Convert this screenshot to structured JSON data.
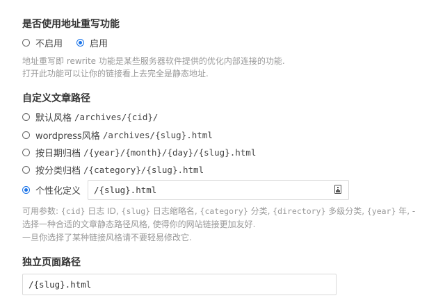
{
  "rewrite": {
    "title": "是否使用地址重写功能",
    "options": [
      {
        "label": "不启用",
        "checked": false
      },
      {
        "label": "启用",
        "checked": true
      }
    ],
    "desc_line1": "地址重写即 rewrite 功能是某些服务器软件提供的优化内部连接的功能.",
    "desc_line2": "打开此功能可以让你的链接看上去完全是静态地址."
  },
  "post_path": {
    "title": "自定义文章路径",
    "options": [
      {
        "label": "默认风格",
        "pattern": "/archives/{cid}/",
        "checked": false
      },
      {
        "label": "wordpress风格",
        "pattern": "/archives/{slug}.html",
        "checked": false
      },
      {
        "label": "按日期归档",
        "pattern": "/{year}/{month}/{day}/{slug}.html",
        "checked": false
      },
      {
        "label": "按分类归档",
        "pattern": "/{category}/{slug}.html",
        "checked": false
      },
      {
        "label": "个性化定义",
        "checked": true
      }
    ],
    "custom_value": "/{slug}.html",
    "params": {
      "prefix": "可用参数: ",
      "p1_code": "{cid}",
      "p1_text": " 日志 ID, ",
      "p2_code": "{slug}",
      "p2_text": " 日志缩略名, ",
      "p3_code": "{category}",
      "p3_text": " 分类, ",
      "p4_code": "{directory}",
      "p4_text": " 多级分类, ",
      "p5_code": "{year}",
      "p5_text": " 年, -"
    },
    "desc_line2": "选择一种合适的文章静态路径风格, 使得你的网站链接更加友好.",
    "desc_line3": "一旦你选择了某种链接风格请不要轻易修改它."
  },
  "page_path": {
    "title": "独立页面路径",
    "value": "/{slug}.html"
  },
  "colors": {
    "accent": "#1a73e8",
    "help_text": "#999999"
  }
}
